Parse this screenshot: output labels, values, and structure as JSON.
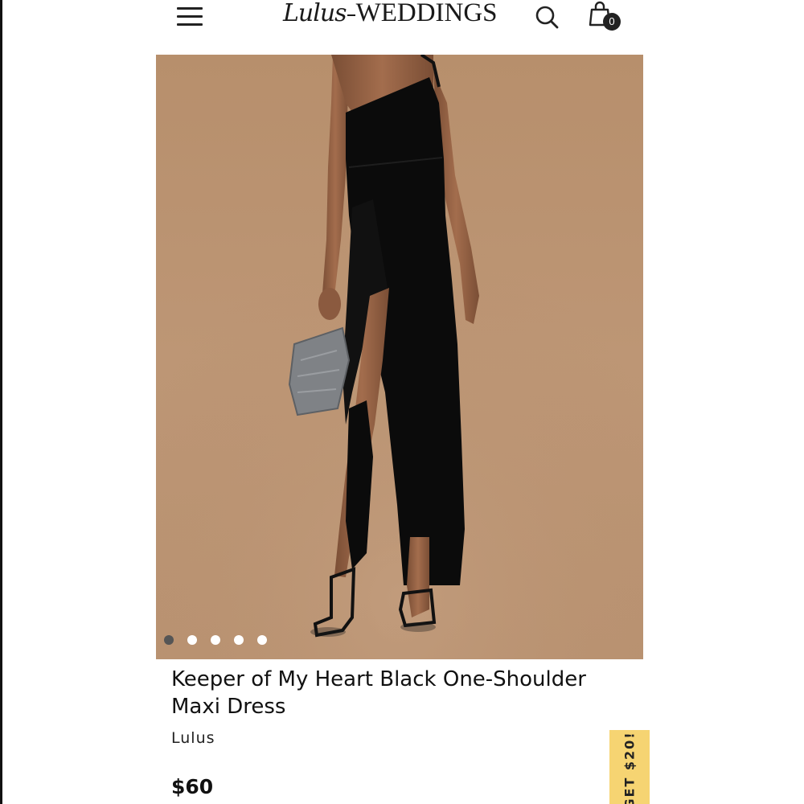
{
  "header": {
    "logo_script": "Lulus",
    "logo_word": "WEDDINGS",
    "menu_icon": "hamburger-menu-icon",
    "search_icon": "search-icon",
    "cart_icon": "shopping-bag-icon",
    "cart_count": "0"
  },
  "product": {
    "title": "Keeper of My Heart Black One-Shoulder Maxi Dress",
    "brand": "Lulus",
    "price": "$60",
    "image_alt": "Model in black one-shoulder maxi dress with side slit, holding a silver sequin clutch, wearing black strappy heels",
    "carousel": {
      "total": 5,
      "active_index": 0
    }
  },
  "promo": {
    "label": "GET $20!"
  },
  "colors": {
    "background": "#ffffff",
    "image_backdrop": "#b8916f",
    "promo": "#f6d472",
    "text": "#111111"
  }
}
